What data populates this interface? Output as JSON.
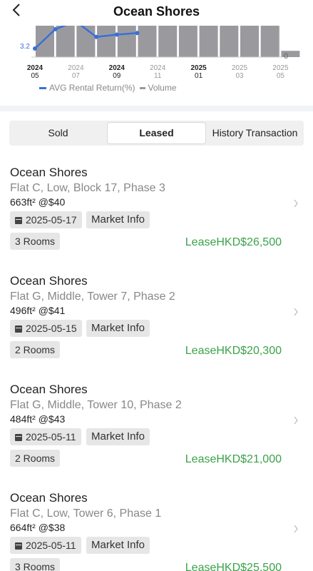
{
  "header": {
    "title": "Ocean Shores"
  },
  "chart_data": {
    "type": "bar",
    "categories": [
      "2024 05",
      "2024 06",
      "2024 07",
      "2024 08",
      "2024 09",
      "2024 10",
      "2024 11",
      "2024 12",
      "2025 01",
      "2025 02",
      "2025 03",
      "2025 04",
      "2025 05"
    ],
    "x_tick_labels": [
      {
        "year": "2024",
        "month": "05"
      },
      {
        "year": "2024",
        "month": "07"
      },
      {
        "year": "2024",
        "month": "09"
      },
      {
        "year": "2024",
        "month": "11"
      },
      {
        "year": "2025",
        "month": "01"
      },
      {
        "year": "2025",
        "month": "03"
      },
      {
        "year": "2025",
        "month": "05"
      }
    ],
    "series": [
      {
        "name": "AVG Rental Return(%)",
        "kind": "line",
        "color": "#3a6fd8",
        "values": [
          3.2,
          3.45,
          3.55,
          3.35,
          3.38,
          3.4
        ]
      },
      {
        "name": "Volume",
        "kind": "bar",
        "color": "#9a9a9e",
        "values": [
          40,
          40,
          40,
          40,
          40,
          40,
          40,
          40,
          40,
          40,
          40,
          40,
          8
        ]
      }
    ],
    "left_axis_label": "3.2",
    "right_axis_label": "0",
    "ylim_volume": [
      0,
      40
    ]
  },
  "tabs": [
    "Sold",
    "Leased",
    "History Transaction"
  ],
  "active_tab": 1,
  "listings": [
    {
      "name": "Ocean Shores",
      "address": "Flat C, Low, Block 17, Phase 3",
      "size": "663ft²  @$40",
      "date": "2025-05-17",
      "market": "Market Info",
      "rooms": "3 Rooms",
      "price": "LeaseHKD$26,500"
    },
    {
      "name": "Ocean Shores",
      "address": "Flat G, Middle, Tower 7, Phase 2",
      "size": "496ft²  @$41",
      "date": "2025-05-15",
      "market": "Market Info",
      "rooms": "2 Rooms",
      "price": "LeaseHKD$20,300"
    },
    {
      "name": "Ocean Shores",
      "address": "Flat G, Middle, Tower 10, Phase 2",
      "size": "484ft²  @$43",
      "date": "2025-05-11",
      "market": "Market Info",
      "rooms": "2 Rooms",
      "price": "LeaseHKD$21,000"
    },
    {
      "name": "Ocean Shores",
      "address": "Flat C, Low, Tower 6, Phase 1",
      "size": "664ft²  @$38",
      "date": "2025-05-11",
      "market": "Market Info",
      "rooms": "3 Rooms",
      "price": "LeaseHKD$25,500"
    }
  ],
  "colors": {
    "accent": "#3aa24a",
    "line": "#3a6fd8",
    "bar": "#9a9a9e"
  }
}
